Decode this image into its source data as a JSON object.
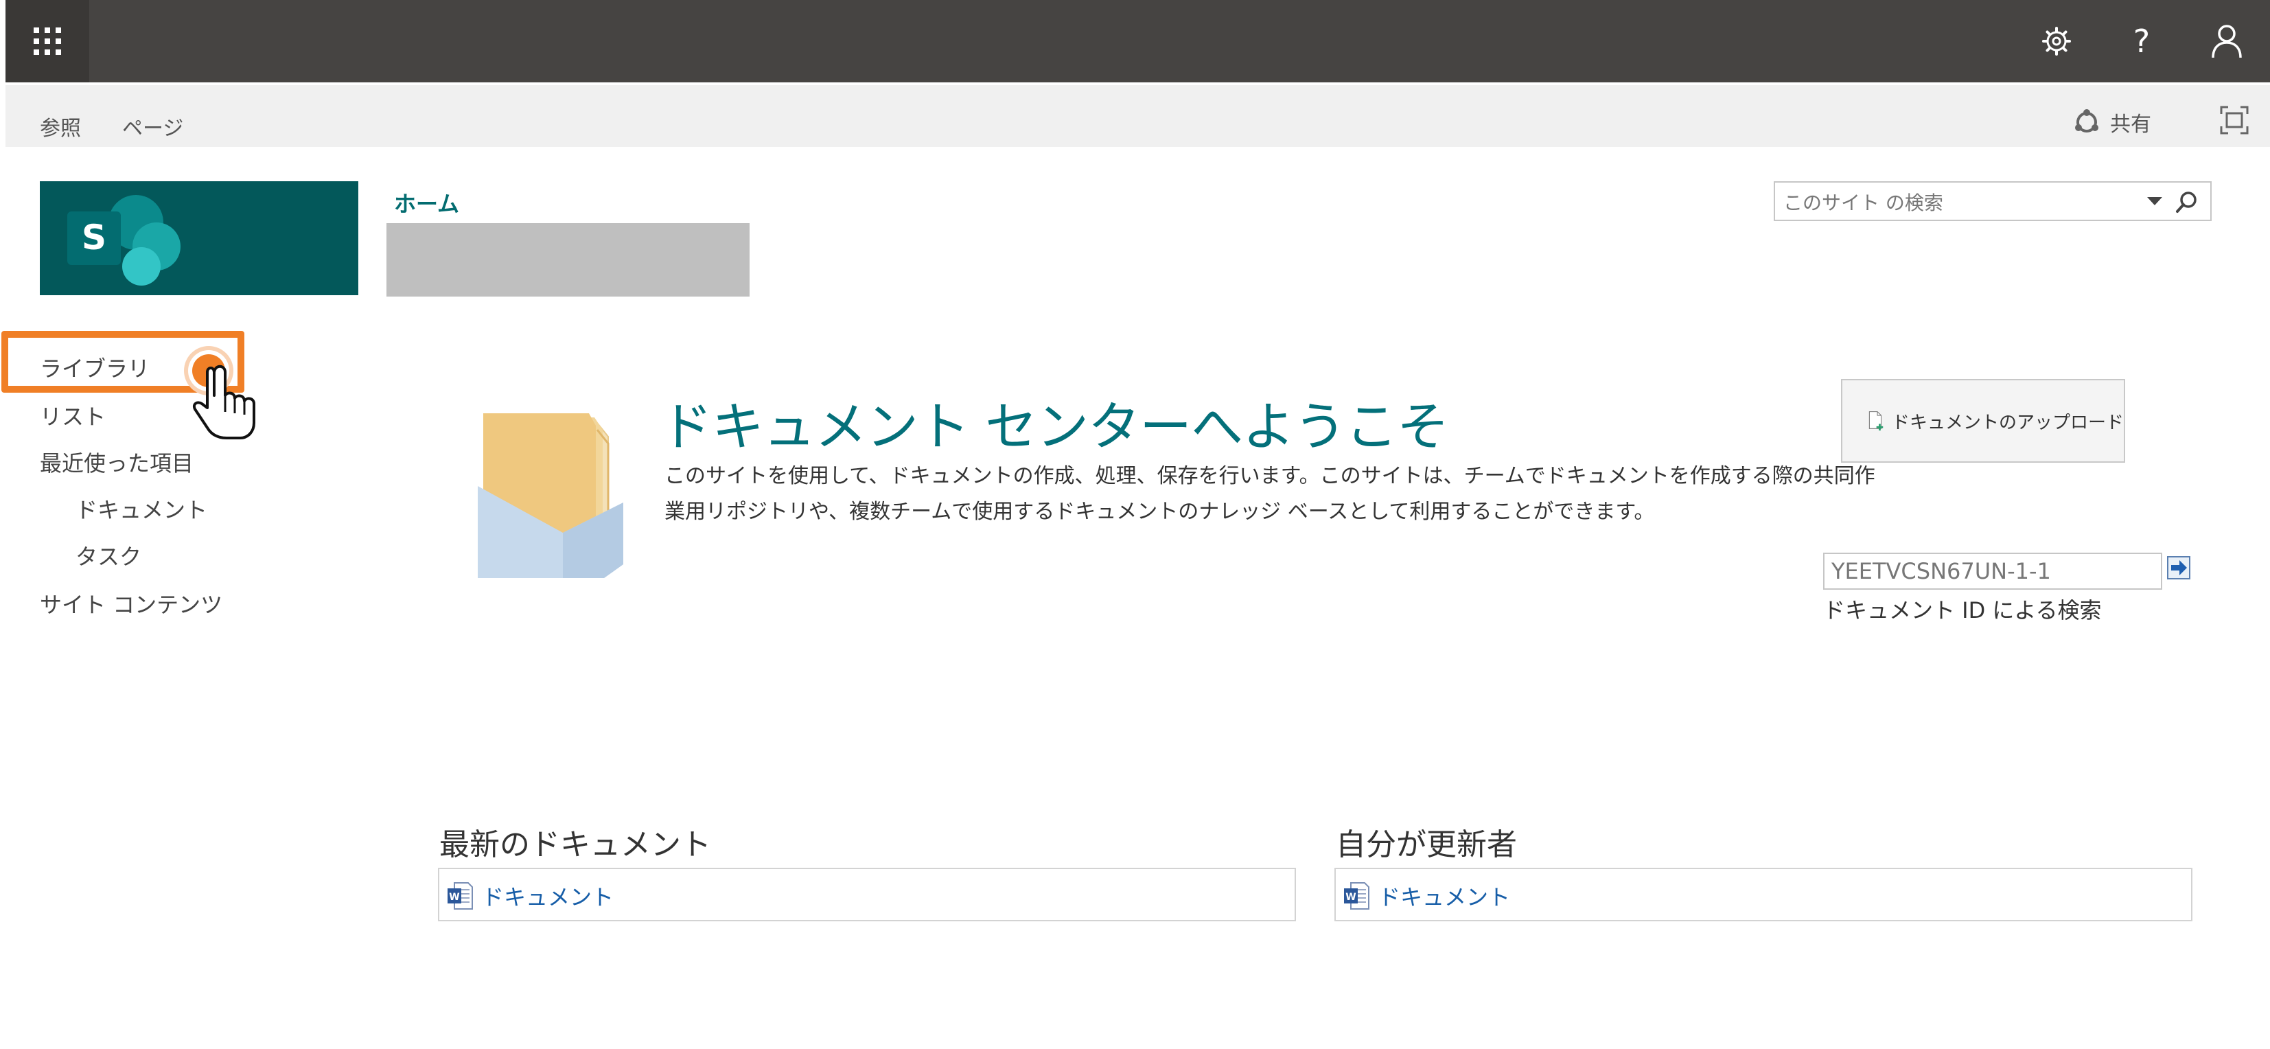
{
  "suite_bar": {
    "icons": [
      "app-launcher-icon",
      "gear-icon",
      "help-icon",
      "person-icon"
    ],
    "help_glyph": "?"
  },
  "ribbon": {
    "tabs": [
      "参照",
      "ページ"
    ],
    "share_label": "共有"
  },
  "breadcrumb": {
    "home": "ホーム"
  },
  "search": {
    "placeholder": "このサイト の検索"
  },
  "left_nav": {
    "items": [
      {
        "label": "ライブラリ",
        "level": 0,
        "highlighted": true
      },
      {
        "label": "リスト",
        "level": 0
      },
      {
        "label": "最近使った項目",
        "level": 0
      },
      {
        "label": "ドキュメント",
        "level": 1
      },
      {
        "label": "タスク",
        "level": 1
      },
      {
        "label": "サイト コンテンツ",
        "level": 0
      }
    ]
  },
  "welcome": {
    "title": "ドキュメント センターへようこそ",
    "lines": [
      "このサイトを使用して、ドキュメントの作成、処理、保存を行います。このサイトは、チームでドキュメントを作成する際の共同作",
      "業用リポジトリや、複数チームで使用するドキュメントのナレッジ ベースとして利用することができます。"
    ]
  },
  "upload": {
    "label": "ドキュメントのアップロード"
  },
  "doc_id_search": {
    "value": "YEETVCSN67UN-1-1",
    "label": "ドキュメント ID による検索"
  },
  "sections": [
    {
      "title": "最新のドキュメント",
      "link": "ドキュメント"
    },
    {
      "title": "自分が更新者",
      "link": "ドキュメント"
    }
  ],
  "colors": {
    "suite_bar": "#464442",
    "accent": "#036c70",
    "highlight": "#f07f26",
    "link": "#175ea8"
  }
}
